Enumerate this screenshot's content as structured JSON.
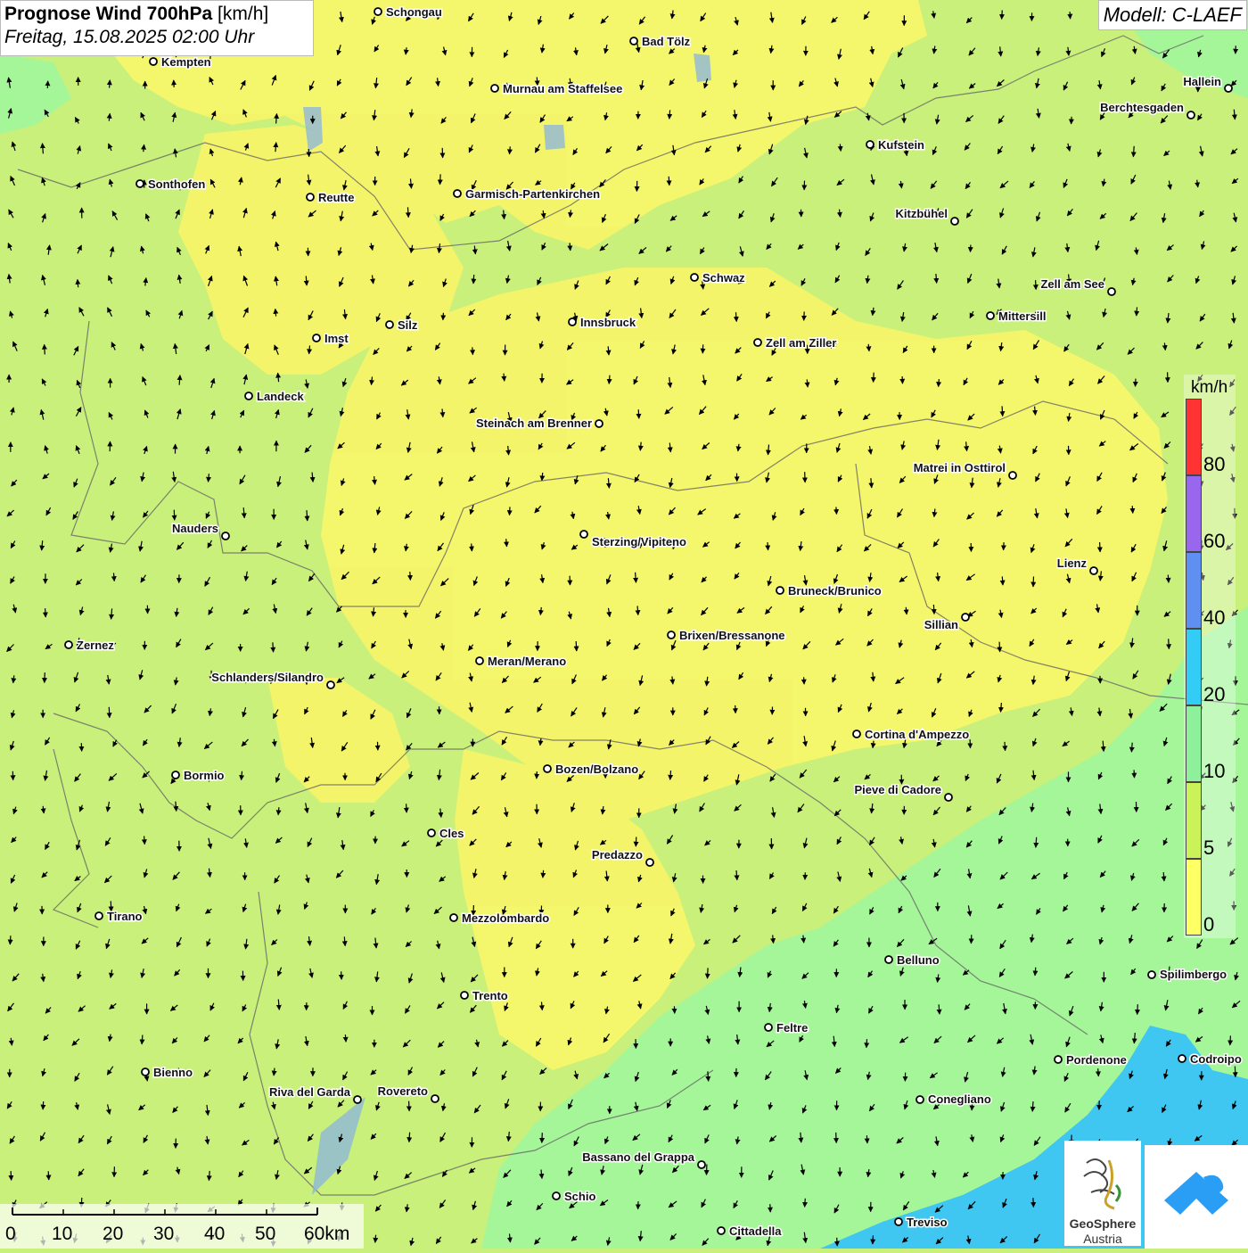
{
  "title": {
    "main": "Prognose Wind 700hPa",
    "unit": "[km/h]",
    "datetime": "Freitag, 15.08.2025 02:00 Uhr"
  },
  "model": "Modell: C-LAEF",
  "legend": {
    "unit": "km/h",
    "labels": [
      "80",
      "60",
      "40",
      "20",
      "10",
      "5",
      "0"
    ],
    "segments": [
      {
        "color": "#ff3333"
      },
      {
        "color": "#9966ee"
      },
      {
        "color": "#5f8ff0"
      },
      {
        "color": "#33ccf5"
      },
      {
        "color": "#8ff09c"
      },
      {
        "color": "#ccf25a"
      },
      {
        "color": "#ffff66"
      }
    ]
  },
  "scale": {
    "labels": [
      "0",
      "10",
      "20",
      "30",
      "40",
      "50",
      "60km"
    ]
  },
  "logo": {
    "line1": "GeoSphere",
    "line2": "Austria"
  },
  "cities": [
    {
      "name": "Schongau"
    },
    {
      "name": "Kempten"
    },
    {
      "name": "Bad Tölz"
    },
    {
      "name": "Murnau am Staffelsee"
    },
    {
      "name": "Hallein"
    },
    {
      "name": "Berchtesgaden"
    },
    {
      "name": "Kufstein"
    },
    {
      "name": "Sonthofen"
    },
    {
      "name": "Reutte"
    },
    {
      "name": "Garmisch-Partenkirchen"
    },
    {
      "name": "Kitzbühel"
    },
    {
      "name": "Schwaz"
    },
    {
      "name": "Zell am See"
    },
    {
      "name": "Mittersill"
    },
    {
      "name": "Silz"
    },
    {
      "name": "Innsbruck"
    },
    {
      "name": "Imst"
    },
    {
      "name": "Zell am Ziller"
    },
    {
      "name": "Landeck"
    },
    {
      "name": "Steinach am Brenner"
    },
    {
      "name": "Matrei in Osttirol"
    },
    {
      "name": "Nauders"
    },
    {
      "name": "Sterzing/Vipiteno"
    },
    {
      "name": "Lienz"
    },
    {
      "name": "Bruneck/Brunico"
    },
    {
      "name": "Sillian"
    },
    {
      "name": "Brixen/Bressanone"
    },
    {
      "name": "Zernez"
    },
    {
      "name": "Meran/Merano"
    },
    {
      "name": "Schlanders/Silandro"
    },
    {
      "name": "Cortina d'Ampezzo"
    },
    {
      "name": "Bozen/Bolzano"
    },
    {
      "name": "Bormio"
    },
    {
      "name": "Pieve di Cadore"
    },
    {
      "name": "Cles"
    },
    {
      "name": "Predazzo"
    },
    {
      "name": "Tirano"
    },
    {
      "name": "Mezzolombardo"
    },
    {
      "name": "Belluno"
    },
    {
      "name": "Spilimbergo"
    },
    {
      "name": "Trento"
    },
    {
      "name": "Feltre"
    },
    {
      "name": "Pordenone"
    },
    {
      "name": "Codroipo"
    },
    {
      "name": "Bienno"
    },
    {
      "name": "Riva del Garda"
    },
    {
      "name": "Rovereto"
    },
    {
      "name": "Conegliano"
    },
    {
      "name": "Bassano del Grappa"
    },
    {
      "name": "Schio"
    },
    {
      "name": "Treviso"
    },
    {
      "name": "Cittadella"
    }
  ]
}
